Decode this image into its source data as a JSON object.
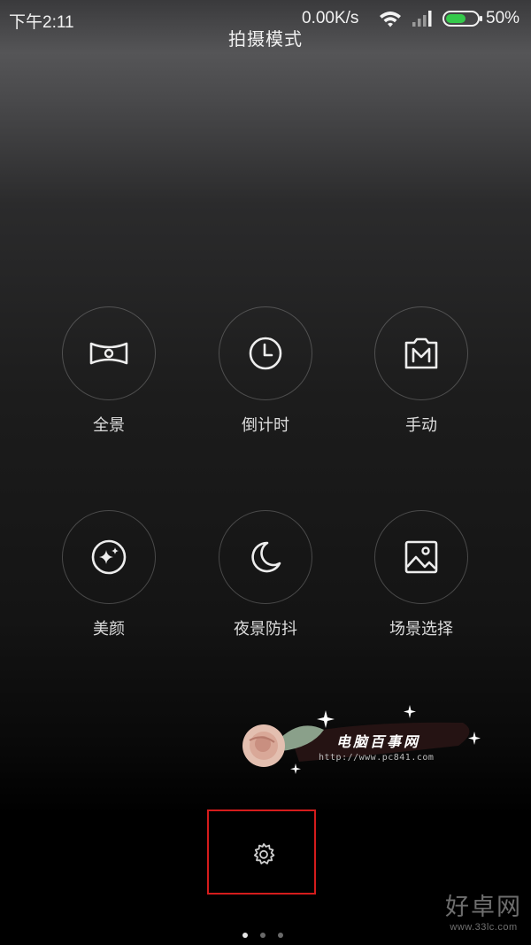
{
  "status_bar": {
    "time": "下午2:11",
    "network_speed": "0.00K/s",
    "battery_percent": "50%",
    "icons": [
      "wifi-icon",
      "cell-signal-icon",
      "battery-icon"
    ],
    "battery_color": "#35c94b"
  },
  "title": "拍摄模式",
  "modes": [
    {
      "label": "全景",
      "icon": "panorama-icon"
    },
    {
      "label": "倒计时",
      "icon": "timer-clock-icon"
    },
    {
      "label": "手动",
      "icon": "manual-m-icon"
    },
    {
      "label": "美颜",
      "icon": "beauty-sparkle-icon"
    },
    {
      "label": "夜景防抖",
      "icon": "night-moon-icon"
    },
    {
      "label": "场景选择",
      "icon": "scene-image-icon"
    }
  ],
  "settings": {
    "icon": "gear-icon",
    "highlight_color": "#d41c1c"
  },
  "pagination": {
    "total": 3,
    "active": 1
  },
  "watermark": {
    "text": "电脑百事网",
    "url": "http://www.pc841.com"
  },
  "site_logo": {
    "name": "好卓网",
    "url": "www.33lc.com"
  }
}
